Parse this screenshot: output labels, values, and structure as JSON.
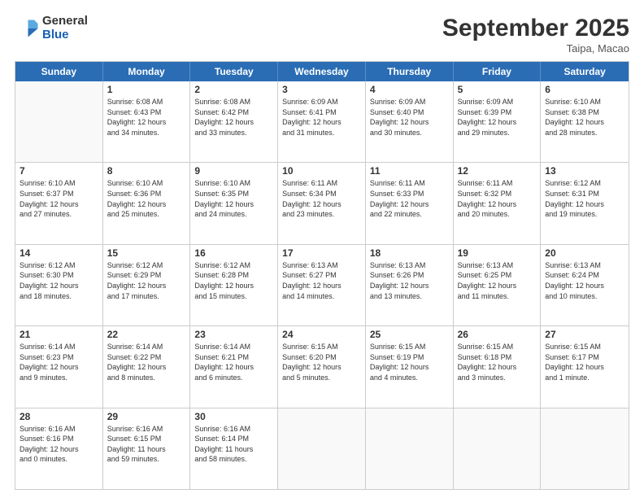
{
  "logo": {
    "general": "General",
    "blue": "Blue"
  },
  "title": "September 2025",
  "location": "Taipa, Macao",
  "header_days": [
    "Sunday",
    "Monday",
    "Tuesday",
    "Wednesday",
    "Thursday",
    "Friday",
    "Saturday"
  ],
  "rows": [
    [
      {
        "day": "",
        "info": ""
      },
      {
        "day": "1",
        "info": "Sunrise: 6:08 AM\nSunset: 6:43 PM\nDaylight: 12 hours\nand 34 minutes."
      },
      {
        "day": "2",
        "info": "Sunrise: 6:08 AM\nSunset: 6:42 PM\nDaylight: 12 hours\nand 33 minutes."
      },
      {
        "day": "3",
        "info": "Sunrise: 6:09 AM\nSunset: 6:41 PM\nDaylight: 12 hours\nand 31 minutes."
      },
      {
        "day": "4",
        "info": "Sunrise: 6:09 AM\nSunset: 6:40 PM\nDaylight: 12 hours\nand 30 minutes."
      },
      {
        "day": "5",
        "info": "Sunrise: 6:09 AM\nSunset: 6:39 PM\nDaylight: 12 hours\nand 29 minutes."
      },
      {
        "day": "6",
        "info": "Sunrise: 6:10 AM\nSunset: 6:38 PM\nDaylight: 12 hours\nand 28 minutes."
      }
    ],
    [
      {
        "day": "7",
        "info": "Sunrise: 6:10 AM\nSunset: 6:37 PM\nDaylight: 12 hours\nand 27 minutes."
      },
      {
        "day": "8",
        "info": "Sunrise: 6:10 AM\nSunset: 6:36 PM\nDaylight: 12 hours\nand 25 minutes."
      },
      {
        "day": "9",
        "info": "Sunrise: 6:10 AM\nSunset: 6:35 PM\nDaylight: 12 hours\nand 24 minutes."
      },
      {
        "day": "10",
        "info": "Sunrise: 6:11 AM\nSunset: 6:34 PM\nDaylight: 12 hours\nand 23 minutes."
      },
      {
        "day": "11",
        "info": "Sunrise: 6:11 AM\nSunset: 6:33 PM\nDaylight: 12 hours\nand 22 minutes."
      },
      {
        "day": "12",
        "info": "Sunrise: 6:11 AM\nSunset: 6:32 PM\nDaylight: 12 hours\nand 20 minutes."
      },
      {
        "day": "13",
        "info": "Sunrise: 6:12 AM\nSunset: 6:31 PM\nDaylight: 12 hours\nand 19 minutes."
      }
    ],
    [
      {
        "day": "14",
        "info": "Sunrise: 6:12 AM\nSunset: 6:30 PM\nDaylight: 12 hours\nand 18 minutes."
      },
      {
        "day": "15",
        "info": "Sunrise: 6:12 AM\nSunset: 6:29 PM\nDaylight: 12 hours\nand 17 minutes."
      },
      {
        "day": "16",
        "info": "Sunrise: 6:12 AM\nSunset: 6:28 PM\nDaylight: 12 hours\nand 15 minutes."
      },
      {
        "day": "17",
        "info": "Sunrise: 6:13 AM\nSunset: 6:27 PM\nDaylight: 12 hours\nand 14 minutes."
      },
      {
        "day": "18",
        "info": "Sunrise: 6:13 AM\nSunset: 6:26 PM\nDaylight: 12 hours\nand 13 minutes."
      },
      {
        "day": "19",
        "info": "Sunrise: 6:13 AM\nSunset: 6:25 PM\nDaylight: 12 hours\nand 11 minutes."
      },
      {
        "day": "20",
        "info": "Sunrise: 6:13 AM\nSunset: 6:24 PM\nDaylight: 12 hours\nand 10 minutes."
      }
    ],
    [
      {
        "day": "21",
        "info": "Sunrise: 6:14 AM\nSunset: 6:23 PM\nDaylight: 12 hours\nand 9 minutes."
      },
      {
        "day": "22",
        "info": "Sunrise: 6:14 AM\nSunset: 6:22 PM\nDaylight: 12 hours\nand 8 minutes."
      },
      {
        "day": "23",
        "info": "Sunrise: 6:14 AM\nSunset: 6:21 PM\nDaylight: 12 hours\nand 6 minutes."
      },
      {
        "day": "24",
        "info": "Sunrise: 6:15 AM\nSunset: 6:20 PM\nDaylight: 12 hours\nand 5 minutes."
      },
      {
        "day": "25",
        "info": "Sunrise: 6:15 AM\nSunset: 6:19 PM\nDaylight: 12 hours\nand 4 minutes."
      },
      {
        "day": "26",
        "info": "Sunrise: 6:15 AM\nSunset: 6:18 PM\nDaylight: 12 hours\nand 3 minutes."
      },
      {
        "day": "27",
        "info": "Sunrise: 6:15 AM\nSunset: 6:17 PM\nDaylight: 12 hours\nand 1 minute."
      }
    ],
    [
      {
        "day": "28",
        "info": "Sunrise: 6:16 AM\nSunset: 6:16 PM\nDaylight: 12 hours\nand 0 minutes."
      },
      {
        "day": "29",
        "info": "Sunrise: 6:16 AM\nSunset: 6:15 PM\nDaylight: 11 hours\nand 59 minutes."
      },
      {
        "day": "30",
        "info": "Sunrise: 6:16 AM\nSunset: 6:14 PM\nDaylight: 11 hours\nand 58 minutes."
      },
      {
        "day": "",
        "info": ""
      },
      {
        "day": "",
        "info": ""
      },
      {
        "day": "",
        "info": ""
      },
      {
        "day": "",
        "info": ""
      }
    ]
  ]
}
